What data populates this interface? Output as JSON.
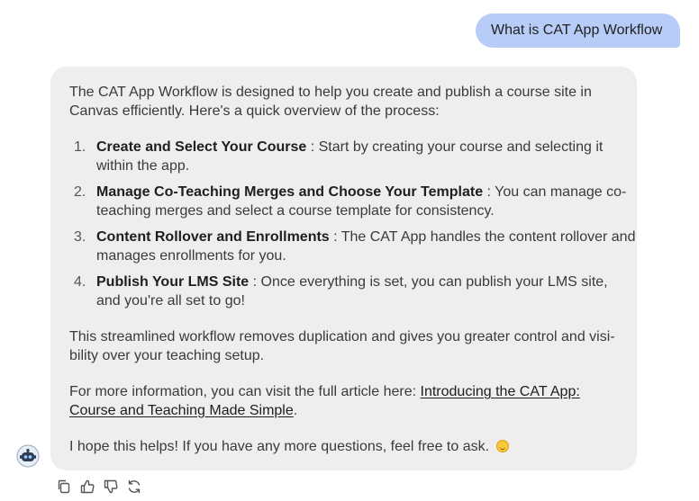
{
  "user_message": "What is CAT App Workflow",
  "response": {
    "intro_line1": "The CAT App Workflow is designed to help you create and publish a course site in",
    "intro_line2": "Canvas efficiently. Here's a quick overview of the process:",
    "steps": [
      {
        "num": "1.",
        "title": "Create and Select Your Course",
        "line1": " : Start by creating your course and selecting it",
        "line2": "within the app."
      },
      {
        "num": "2.",
        "title": "Manage Co-Teaching Merges and Choose Your Template",
        "line1": " : You can manage co-",
        "line2": "teaching merges and select a course template for consistency."
      },
      {
        "num": "3.",
        "title": "Content Rollover and Enrollments",
        "line1": " : The CAT App handles the content rollover and",
        "line2": "manages enrollments for you."
      },
      {
        "num": "4.",
        "title": "Publish Your LMS Site",
        "line1": " : Once everything is set, you can publish your LMS site,",
        "line2": "and you're all set to go!"
      }
    ],
    "summary_line1": "This streamlined workflow removes duplication and gives you greater control and visi-",
    "summary_line2": "bility over your teaching setup.",
    "more_info_prefix": "For more information, you can visit the full article here: ",
    "link_line1": "Introducing the CAT App:",
    "link_line2": "Course and Teaching Made Simple",
    "link_suffix": ".",
    "closing": "I hope this helps! If you have any more questions, feel free to ask. "
  },
  "icons": {
    "avatar": "bot-avatar-icon",
    "actions": [
      "copy-icon",
      "thumbs-up-icon",
      "thumbs-down-icon",
      "regenerate-icon"
    ]
  },
  "colors": {
    "user_bubble": "#b7cdf8",
    "bot_bubble": "#eeeeee"
  }
}
